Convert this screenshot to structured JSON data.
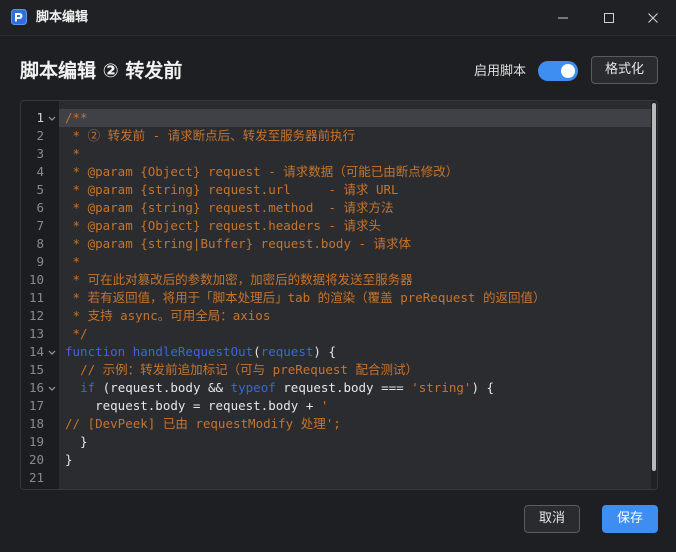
{
  "window": {
    "title": "脚本编辑"
  },
  "header": {
    "title": "脚本编辑 ② 转发前",
    "toggle_label": "启用脚本",
    "toggle_on": true,
    "format_label": "格式化"
  },
  "editor": {
    "active_line": 1,
    "lines": [
      {
        "n": "1",
        "fold": true,
        "tokens": [
          {
            "t": "c-comment",
            "s": "/**"
          }
        ]
      },
      {
        "n": "2",
        "fold": false,
        "tokens": [
          {
            "t": "c-comment",
            "s": " * ② 转发前 - 请求断点后、转发至服务器前执行"
          }
        ]
      },
      {
        "n": "3",
        "fold": false,
        "tokens": [
          {
            "t": "c-comment",
            "s": " *"
          }
        ]
      },
      {
        "n": "4",
        "fold": false,
        "tokens": [
          {
            "t": "c-comment",
            "s": " * @param {Object} request - 请求数据（可能已由断点修改）"
          }
        ]
      },
      {
        "n": "5",
        "fold": false,
        "tokens": [
          {
            "t": "c-comment",
            "s": " * @param {string} request.url     - 请求 URL"
          }
        ]
      },
      {
        "n": "6",
        "fold": false,
        "tokens": [
          {
            "t": "c-comment",
            "s": " * @param {string} request.method  - 请求方法"
          }
        ]
      },
      {
        "n": "7",
        "fold": false,
        "tokens": [
          {
            "t": "c-comment",
            "s": " * @param {Object} request.headers - 请求头"
          }
        ]
      },
      {
        "n": "8",
        "fold": false,
        "tokens": [
          {
            "t": "c-comment",
            "s": " * @param {string|Buffer} request.body - 请求体"
          }
        ]
      },
      {
        "n": "9",
        "fold": false,
        "tokens": [
          {
            "t": "c-comment",
            "s": " *"
          }
        ]
      },
      {
        "n": "10",
        "fold": false,
        "tokens": [
          {
            "t": "c-comment",
            "s": " * 可在此对篡改后的参数加密，加密后的数据将发送至服务器"
          }
        ]
      },
      {
        "n": "11",
        "fold": false,
        "tokens": [
          {
            "t": "c-comment",
            "s": " * 若有返回值，将用于「脚本处理后」tab 的渲染（覆盖 preRequest 的返回值）"
          }
        ]
      },
      {
        "n": "12",
        "fold": false,
        "tokens": [
          {
            "t": "c-comment",
            "s": " * 支持 async。可用全局：axios"
          }
        ]
      },
      {
        "n": "13",
        "fold": false,
        "tokens": [
          {
            "t": "c-comment",
            "s": " */"
          }
        ]
      },
      {
        "n": "14",
        "fold": true,
        "tokens": [
          {
            "t": "c-keyword",
            "s": "function"
          },
          {
            "t": "c-plain",
            "s": " "
          },
          {
            "t": "c-func",
            "s": "handleRequestOut"
          },
          {
            "t": "c-plain",
            "s": "("
          },
          {
            "t": "c-keyword",
            "s": "request"
          },
          {
            "t": "c-plain",
            "s": ") {"
          }
        ]
      },
      {
        "n": "15",
        "fold": false,
        "tokens": [
          {
            "t": "c-plain",
            "s": "  "
          },
          {
            "t": "c-comment",
            "s": "// 示例：转发前追加标记（可与 preRequest 配合测试）"
          }
        ]
      },
      {
        "n": "16",
        "fold": true,
        "tokens": [
          {
            "t": "c-plain",
            "s": "  "
          },
          {
            "t": "c-keyword",
            "s": "if"
          },
          {
            "t": "c-plain",
            "s": " (request.body && "
          },
          {
            "t": "c-keyword",
            "s": "typeof"
          },
          {
            "t": "c-plain",
            "s": " request.body === "
          },
          {
            "t": "c-string",
            "s": "'string'"
          },
          {
            "t": "c-plain",
            "s": ") {"
          }
        ]
      },
      {
        "n": "17",
        "fold": false,
        "tokens": [
          {
            "t": "c-plain",
            "s": "    request.body = request.body + "
          },
          {
            "t": "c-string",
            "s": "'"
          }
        ]
      },
      {
        "n": "18",
        "fold": false,
        "tokens": [
          {
            "t": "c-comment",
            "s": "// [DevPeek] 已由 requestModify 处理';"
          }
        ]
      },
      {
        "n": "19",
        "fold": false,
        "tokens": [
          {
            "t": "c-plain",
            "s": "  }"
          }
        ]
      },
      {
        "n": "20",
        "fold": false,
        "tokens": [
          {
            "t": "c-plain",
            "s": "}"
          }
        ]
      },
      {
        "n": "21",
        "fold": false,
        "tokens": []
      }
    ]
  },
  "footer": {
    "cancel_label": "取消",
    "save_label": "保存"
  },
  "colors": {
    "accent": "#3d8ef0",
    "comment": "#c6742c",
    "keyword": "#3a67d8"
  },
  "icons": {
    "app": "app-logo-icon",
    "minimize": "minimize-icon",
    "maximize": "maximize-icon",
    "close": "close-icon",
    "fold": "chevron-down-icon"
  }
}
